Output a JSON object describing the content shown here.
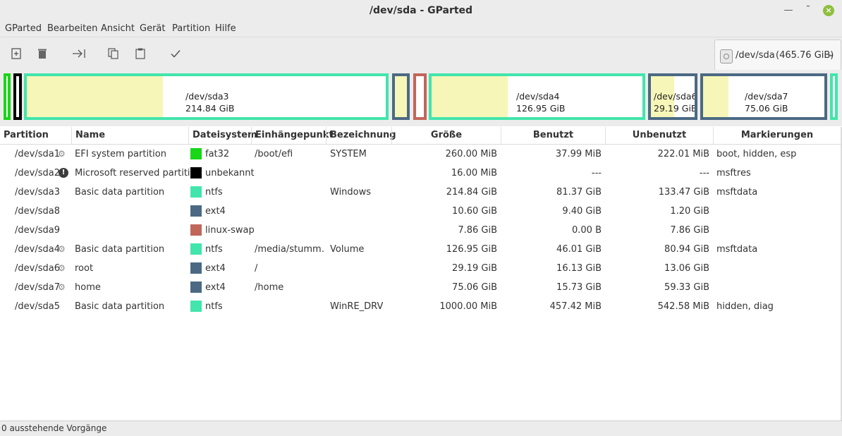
{
  "window": {
    "title": "/dev/sda - GParted"
  },
  "menu": [
    "GParted",
    "Bearbeiten",
    "Ansicht",
    "Gerät",
    "Partition",
    "Hilfe"
  ],
  "toolbar": {
    "icons": [
      "new-partition-icon",
      "delete-icon",
      "resize-move-icon",
      "copy-icon",
      "paste-icon",
      "apply-icon"
    ]
  },
  "device_selector": {
    "device": "/dev/sda",
    "size": "(465.76 GiB)"
  },
  "disk_map": {
    "labels": {
      "sda3": {
        "name": "/dev/sda3",
        "size": "214.84 GiB"
      },
      "sda4": {
        "name": "/dev/sda4",
        "size": "126.95 GiB"
      },
      "sda6": {
        "name": "/dev/sda6",
        "size": "29.19 GiB"
      },
      "sda7": {
        "name": "/dev/sda7",
        "size": "75.06 GiB"
      }
    },
    "colors": {
      "fat32": "#18d618",
      "unknown": "#000000",
      "ntfs": "#42e5ac",
      "ext4": "#4b6983",
      "linux-swap": "#c1665a",
      "used": "#f6f6b8"
    }
  },
  "table": {
    "headers": [
      "Partition",
      "Name",
      "Dateisystem",
      "Einhängepunkt",
      "Bezeichnung",
      "Größe",
      "Benutzt",
      "Unbenutzt",
      "Markierungen"
    ],
    "rows": [
      {
        "partition": "/dev/sda1",
        "icon": "key-icon",
        "name": "EFI system partition",
        "fs": "fat32",
        "fs_color": "#18d618",
        "mount": "/boot/efi",
        "label": "SYSTEM",
        "size": "260.00 MiB",
        "used": "37.99 MiB",
        "unused": "222.01 MiB",
        "flags": "boot, hidden, esp"
      },
      {
        "partition": "/dev/sda2",
        "icon": "warning-icon",
        "name": "Microsoft reserved partition",
        "fs": "unbekannt",
        "fs_color": "#000000",
        "mount": "",
        "label": "",
        "size": "16.00 MiB",
        "used": "---",
        "unused": "---",
        "flags": "msftres"
      },
      {
        "partition": "/dev/sda3",
        "icon": "",
        "name": "Basic data partition",
        "fs": "ntfs",
        "fs_color": "#42e5ac",
        "mount": "",
        "label": "Windows",
        "size": "214.84 GiB",
        "used": "81.37 GiB",
        "unused": "133.47 GiB",
        "flags": "msftdata"
      },
      {
        "partition": "/dev/sda8",
        "icon": "",
        "name": "",
        "fs": "ext4",
        "fs_color": "#4b6983",
        "mount": "",
        "label": "",
        "size": "10.60 GiB",
        "used": "9.40 GiB",
        "unused": "1.20 GiB",
        "flags": ""
      },
      {
        "partition": "/dev/sda9",
        "icon": "",
        "name": "",
        "fs": "linux-swap",
        "fs_color": "#c1665a",
        "mount": "",
        "label": "",
        "size": "7.86 GiB",
        "used": "0.00 B",
        "unused": "7.86 GiB",
        "flags": ""
      },
      {
        "partition": "/dev/sda4",
        "icon": "key-icon",
        "name": "Basic data partition",
        "fs": "ntfs",
        "fs_color": "#42e5ac",
        "mount": "/media/stumm…",
        "label": "Volume",
        "size": "126.95 GiB",
        "used": "46.01 GiB",
        "unused": "80.94 GiB",
        "flags": "msftdata"
      },
      {
        "partition": "/dev/sda6",
        "icon": "key-icon",
        "name": "root",
        "fs": "ext4",
        "fs_color": "#4b6983",
        "mount": "/",
        "label": "",
        "size": "29.19 GiB",
        "used": "16.13 GiB",
        "unused": "13.06 GiB",
        "flags": ""
      },
      {
        "partition": "/dev/sda7",
        "icon": "key-icon",
        "name": "home",
        "fs": "ext4",
        "fs_color": "#4b6983",
        "mount": "/home",
        "label": "",
        "size": "75.06 GiB",
        "used": "15.73 GiB",
        "unused": "59.33 GiB",
        "flags": ""
      },
      {
        "partition": "/dev/sda5",
        "icon": "",
        "name": "Basic data partition",
        "fs": "ntfs",
        "fs_color": "#42e5ac",
        "mount": "",
        "label": "WinRE_DRV",
        "size": "1000.00 MiB",
        "used": "457.42 MiB",
        "unused": "542.58 MiB",
        "flags": "hidden, diag"
      }
    ]
  },
  "status": {
    "text": "0 ausstehende Vorgänge"
  }
}
